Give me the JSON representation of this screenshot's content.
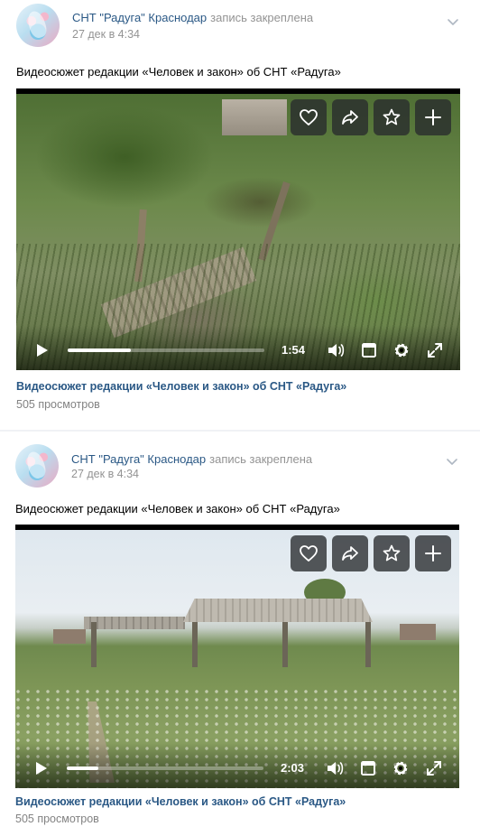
{
  "posts": [
    {
      "author": "СНТ \"Радуга\" Краснодар",
      "action": "запись закреплена",
      "date": "27 дек в 4:34",
      "text": "Видеосюжет редакции «Человек и закон» об СНТ «Радуга»",
      "video": {
        "duration": "1:54",
        "progress": 0.32,
        "title": "Видеосюжет редакции «Человек и закон» об СНТ «Радуга»",
        "views": "505 просмотров"
      }
    },
    {
      "author": "СНТ \"Радуга\" Краснодар",
      "action": "запись закреплена",
      "date": "27 дек в 4:34",
      "text": "Видеосюжет редакции «Человек и закон» об СНТ «Радуга»",
      "video": {
        "duration": "2:03",
        "progress": 0.16,
        "title": "Видеосюжет редакции «Человек и закон» об СНТ «Радуга»",
        "views": "505 просмотров"
      }
    }
  ],
  "icons": {
    "like": "heart-icon",
    "share": "share-icon",
    "favorite": "star-icon",
    "add": "plus-icon",
    "play": "play-icon",
    "volume": "volume-icon",
    "miniplayer": "miniplayer-icon",
    "settings": "gear-icon",
    "fullscreen": "fullscreen-icon",
    "menu": "chevron-down-icon"
  },
  "colors": {
    "link": "#2a5885",
    "muted": "#939393",
    "button_bg": "#282a2d"
  }
}
